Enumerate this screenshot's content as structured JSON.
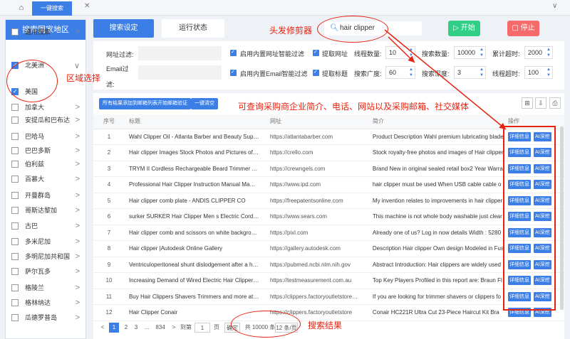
{
  "topbar": {
    "home_icon": "home-icon",
    "tab_label": "一键搜索",
    "close_icon": "close-icon",
    "overflow_icon": "chevron-down-icon"
  },
  "sidebar": {
    "title": "搜索国家地区",
    "items": [
      {
        "label": "通用搜索",
        "checked": false,
        "arrow": ">"
      },
      {
        "label": "北美洲",
        "checked": true,
        "arrow": "∨"
      },
      {
        "label": "美国",
        "checked": true,
        "arrow": ""
      },
      {
        "label": "加拿大",
        "checked": false,
        "arrow": ">"
      },
      {
        "label": "安提瓜和巴布达",
        "checked": false,
        "arrow": ">"
      },
      {
        "label": "巴哈马",
        "checked": false,
        "arrow": ">"
      },
      {
        "label": "巴巴多斯",
        "checked": false,
        "arrow": ">"
      },
      {
        "label": "伯利兹",
        "checked": false,
        "arrow": ">"
      },
      {
        "label": "百慕大",
        "checked": false,
        "arrow": ">"
      },
      {
        "label": "开曼群岛",
        "checked": false,
        "arrow": ">"
      },
      {
        "label": "哥斯达黎加",
        "checked": false,
        "arrow": ">"
      },
      {
        "label": "古巴",
        "checked": false,
        "arrow": ">"
      },
      {
        "label": "多米尼加",
        "checked": false,
        "arrow": ">"
      },
      {
        "label": "多明尼加共和国",
        "checked": false,
        "arrow": ">"
      },
      {
        "label": "萨尔瓦多",
        "checked": false,
        "arrow": ">"
      },
      {
        "label": "格陵兰",
        "checked": false,
        "arrow": ">"
      },
      {
        "label": "格林纳达",
        "checked": false,
        "arrow": ">"
      },
      {
        "label": "瓜德罗普岛",
        "checked": false,
        "arrow": ">"
      }
    ]
  },
  "toolbar": {
    "search_settings": "搜索设定",
    "run_status": "运行状态",
    "keyword": "hair clipper",
    "start": "开始",
    "stop": "停止"
  },
  "form": {
    "url_filter": "网址过滤:",
    "email_filter": "Email过滤:",
    "opt1": "启用内置网址智能过滤",
    "opt2": "启用内置Email智能过滤",
    "get_url": "提取网址",
    "get_title": "提取标题",
    "threads_label": "线程数量:",
    "threads": "10",
    "search_count_label": "搜索数量:",
    "search_count": "10000",
    "timeout_label": "累计超时:",
    "timeout": "2000",
    "breadth_label": "搜索广度:",
    "breadth": "60",
    "depth_label": "搜索深度:",
    "depth": "3",
    "thread_timeout_label": "线程超时:",
    "thread_timeout": "100"
  },
  "panel": {
    "add_all": "所有结果添加到邮箱列表开始邮箱验证",
    "clear": "一键清空"
  },
  "table": {
    "headers": [
      "序号",
      "标题",
      "网址",
      "简介",
      "操作"
    ],
    "detail": "详细信息",
    "ai": "AI深挖",
    "rows": [
      {
        "no": "1",
        "title": "Wahl Clipper Oil - Atlanta Barber and Beauty Sup…",
        "url": "https://atlantabarber.com",
        "desc": "Product Description Wahl premium lubricating blade"
      },
      {
        "no": "2",
        "title": "Hair clipper Images Stock Photos and Pictures of…",
        "url": "https://crello.com",
        "desc": "Stock royalty-free photos and images of Hair clipper"
      },
      {
        "no": "3",
        "title": "TRYM II Cordless Rechargeable Beard Trimmer …",
        "url": "https://crewngels.com",
        "desc": "Brand New in original sealed retail box2 Year Warra"
      },
      {
        "no": "4",
        "title": "Professional Hair Clipper Instruction Manual Ma…",
        "url": "https://www.ipd.com",
        "desc": "hair clipper must be used When USB cable cable o"
      },
      {
        "no": "5",
        "title": "Hair clipper comb plate - ANDIS CLIPPER CO",
        "url": "https://freepatentsonline.com",
        "desc": "My invention relates to improvements in hair clipper"
      },
      {
        "no": "6",
        "title": "surker SURKER Hair Clipper Men s Electric Cord…",
        "url": "https://www.sears.com",
        "desc": "This machine is not whole body washable just clear"
      },
      {
        "no": "7",
        "title": "Hair clipper comb and scissors on white backgro…",
        "url": "https://pixl.com",
        "desc": "Already one of us? Log in now details Width : 5280"
      },
      {
        "no": "8",
        "title": "Hair clipper |Autodesk Online Gallery",
        "url": "https://gallery.autodesk.com",
        "desc": "Description Hair clipper Own design Modeled in Fus"
      },
      {
        "no": "9",
        "title": "Ventriculoperitoneal shunt dislodgement after a h…",
        "url": "https://pubmed.ncbi.nlm.nih.gov",
        "desc": "Abstract Introduction: Hair clippers are widely used"
      },
      {
        "no": "10",
        "title": "Increasing Demand of Wired Electric Hair Clipper…",
        "url": "https://testmeasurement.com.au",
        "desc": "Top Key Players Profiled in this report are: Braun Fl"
      },
      {
        "no": "11",
        "title": "Buy Hair Clippers Shavers Trimmers and more at…",
        "url": "https://clippers.factoryoutletstore…",
        "desc": "If you are looking for trimmer shavers or clippers fo"
      },
      {
        "no": "12",
        "title": "Hair Clipper Conair",
        "url": "https://clippers.factoryoutletstore",
        "desc": "Conair HC221R Ultra Cut 23-Piece Haircut Kit Bra"
      }
    ]
  },
  "pager": {
    "prev": "<",
    "p1": "1",
    "p2": "2",
    "p3": "3",
    "dots": "...",
    "last": "834",
    "next": ">",
    "goto": "到第",
    "page_input": "1",
    "page_unit": "页",
    "confirm": "确定",
    "total": "共 10000 条",
    "per_page": "12 条/页"
  },
  "annotations": {
    "keyword_note": "头发修剪器",
    "region_note": "区域选择",
    "info_note": "可查询采购商企业简介、电话、网站以及采购邮箱、社交媒体",
    "results_note": "搜索结果"
  },
  "colors": {
    "primary": "#3a7ee6",
    "annotation": "#e8220e",
    "start": "#2fcf86",
    "stop": "#f56b6b"
  }
}
